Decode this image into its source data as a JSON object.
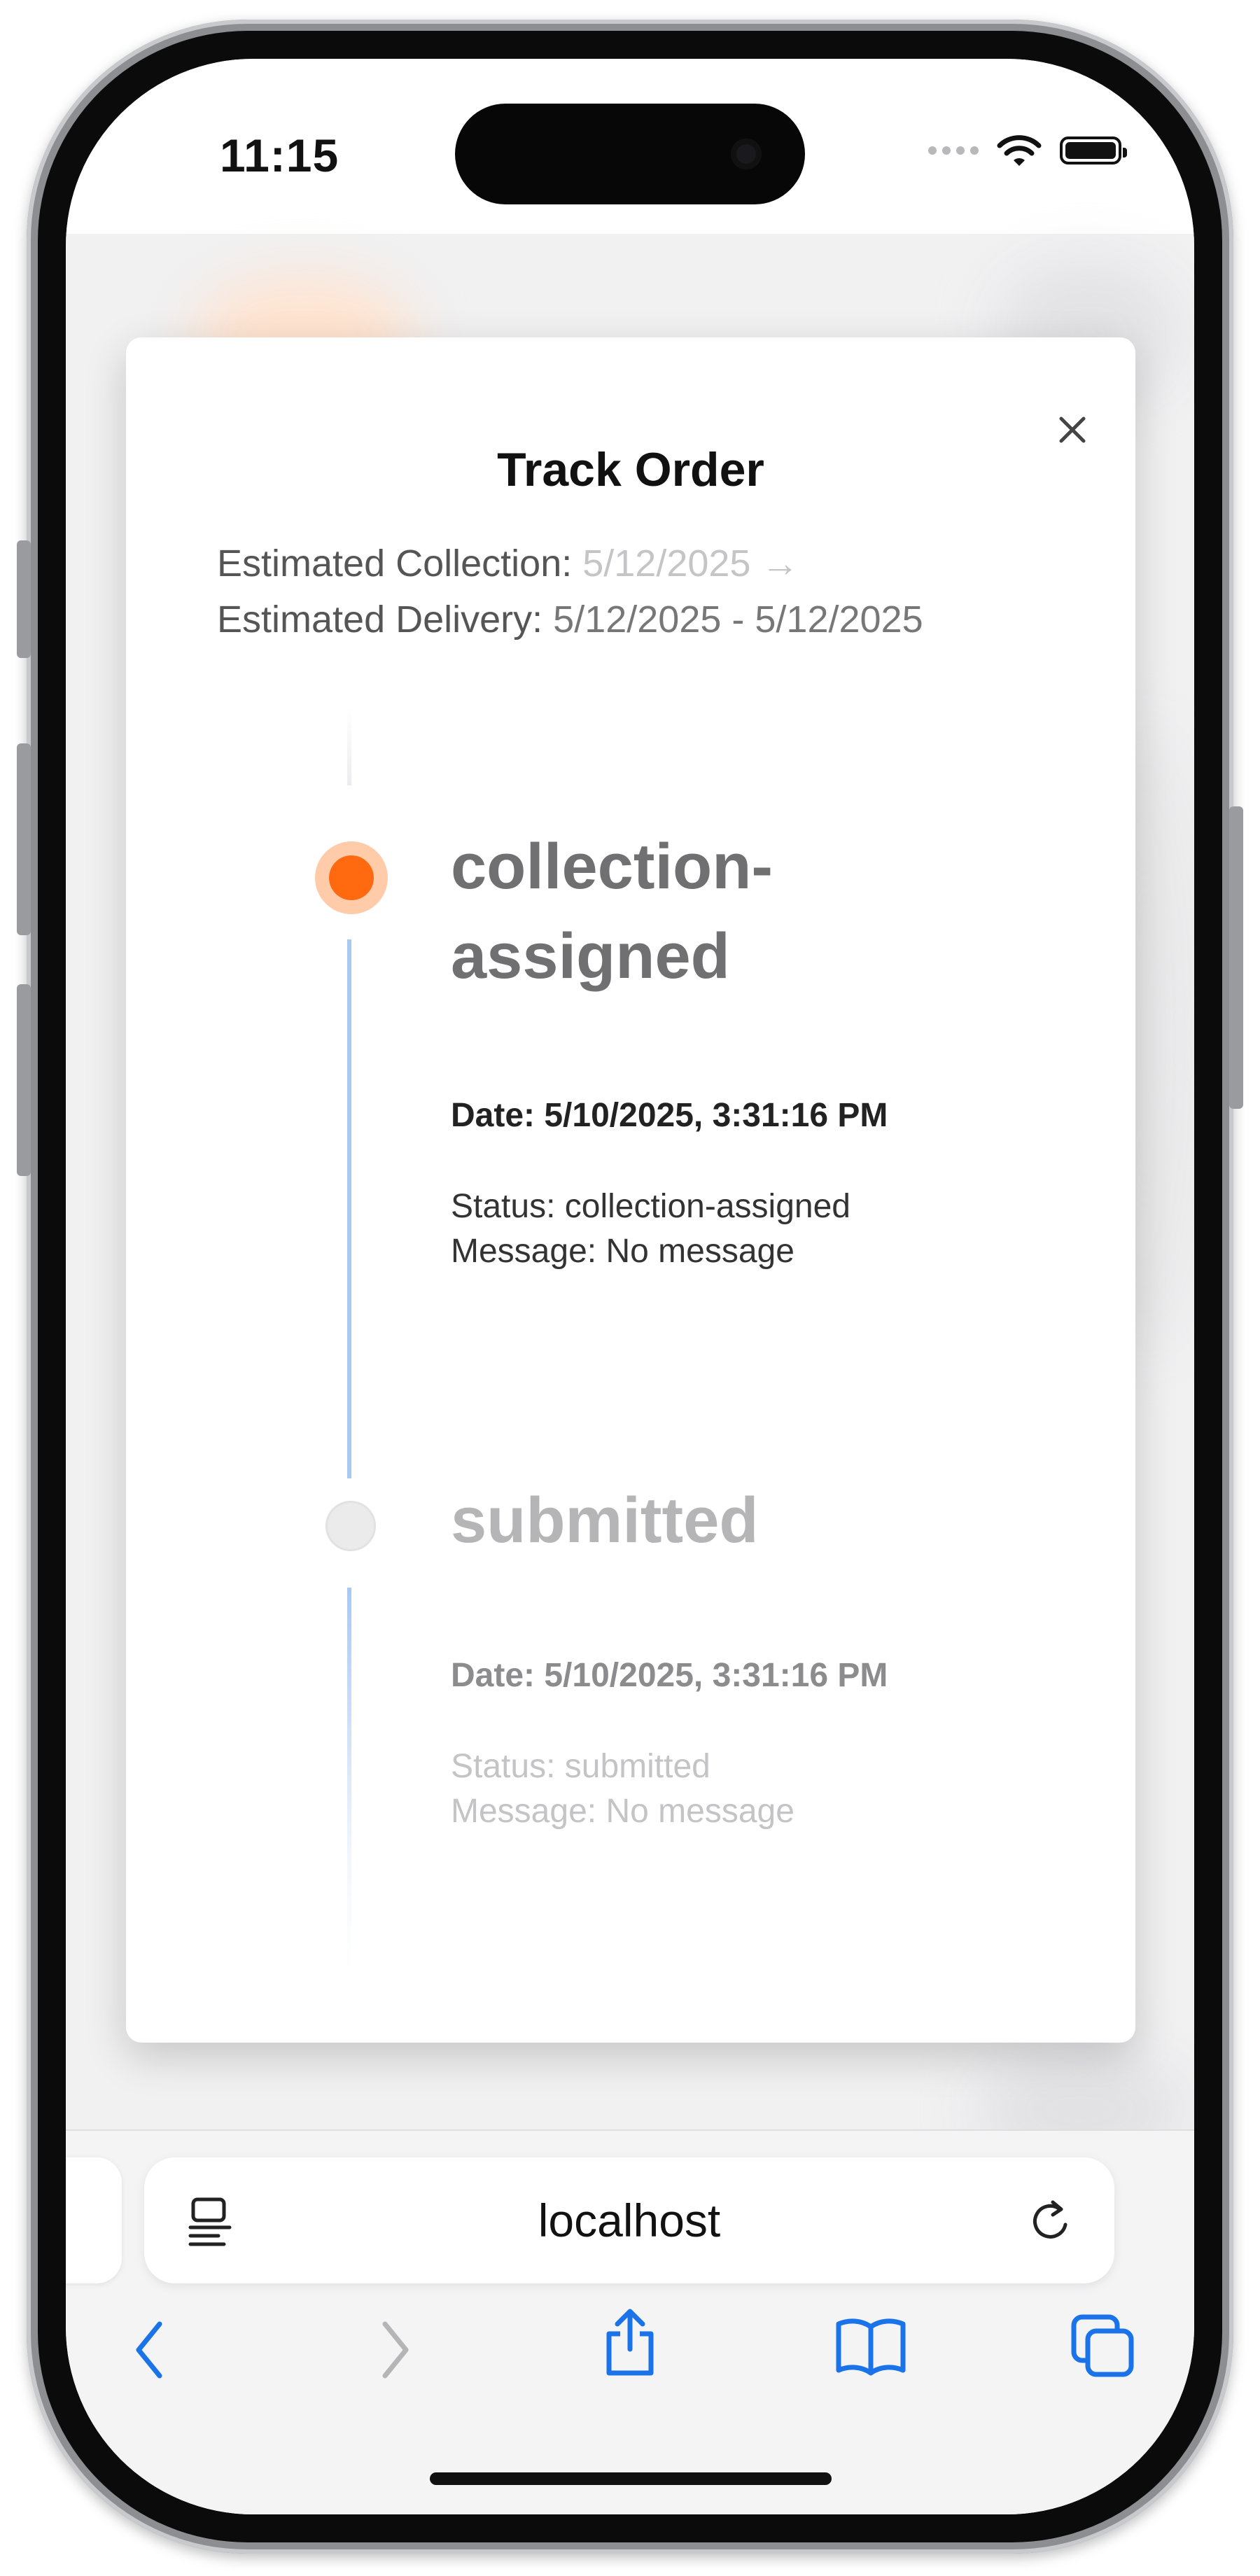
{
  "status_bar": {
    "time": "11:15"
  },
  "modal": {
    "title": "Track Order",
    "estimated_collection_label": "Estimated Collection: ",
    "estimated_collection_value": "5/12/2025 →",
    "estimated_delivery_label": "Estimated Delivery: ",
    "estimated_delivery_value": "5/12/2025 - 5/12/2025"
  },
  "timeline": [
    {
      "title_line1": "collection-",
      "title_line2": "assigned",
      "date": "Date: 5/10/2025, 3:31:16 PM",
      "status": "Status: collection-assigned",
      "message": "Message: No message",
      "active": true
    },
    {
      "title_line1": "submitted",
      "date": "Date: 5/10/2025, 3:31:16 PM",
      "status": "Status: submitted",
      "message": "Message: No message",
      "active": false
    }
  ],
  "browser": {
    "url": "localhost"
  },
  "colors": {
    "accent": "#ff6a10",
    "accent_halo": "#ffcba8",
    "ios_blue": "#1a73e8",
    "timeline_line": "#a9c8f2"
  },
  "icons": [
    "close-icon",
    "reader-icon",
    "reload-icon",
    "back-icon",
    "forward-icon",
    "share-icon",
    "bookmarks-icon",
    "tabs-icon",
    "wifi-icon",
    "battery-icon"
  ]
}
